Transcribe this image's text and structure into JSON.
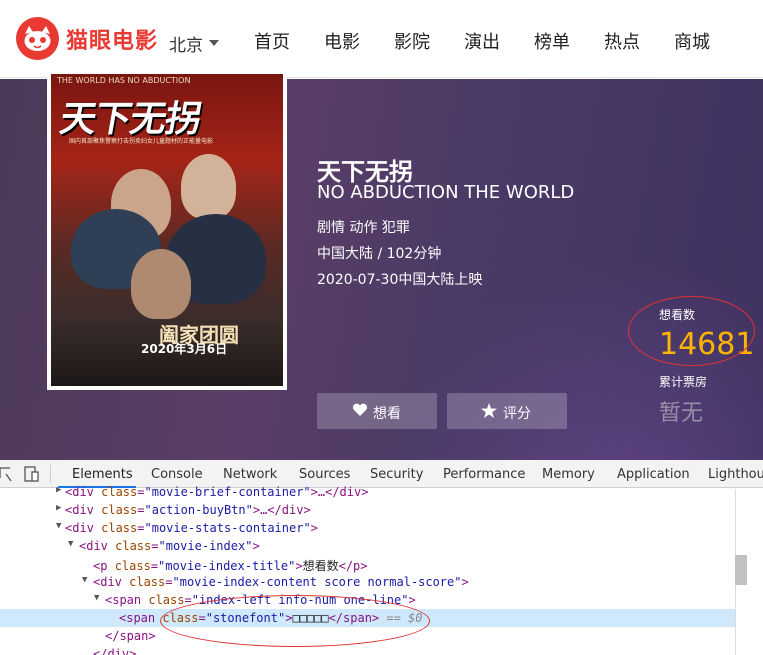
{
  "header": {
    "brand": "猫眼电影",
    "city": "北京",
    "nav": [
      "首页",
      "电影",
      "影院",
      "演出",
      "榜单",
      "热点",
      "商城"
    ]
  },
  "movie": {
    "title": "天下无拐",
    "english_title": "NO ABDUCTION THE WORLD",
    "genres": "剧情 动作 犯罪",
    "region_duration": "中国大陆 / 102分钟",
    "release": "2020-07-30中国大陆上映",
    "want_label": "想看",
    "rate_label": "评分"
  },
  "poster": {
    "top_text": "THE WORLD HAS NO ABDUCTION",
    "title": "天下无拐",
    "subtitle": "国内首部聚焦警察打击拐卖妇女儿童题材的正能量电影",
    "brand": "阖家团圆",
    "date": "2020年3月6日"
  },
  "stats": {
    "want_count_label": "想看数",
    "want_count": "14681",
    "box_office_label": "累计票房",
    "box_office_value": "暂无"
  },
  "devtools": {
    "tabs": [
      "Elements",
      "Console",
      "Network",
      "Sources",
      "Security",
      "Performance",
      "Memory",
      "Application",
      "Lighthouse"
    ],
    "active_tab": "Elements",
    "lines": [
      {
        "pre": "<div class=\"",
        "cls": "movie-brief-container",
        "post": "\">…</div>"
      },
      {
        "pre": "<div class=\"",
        "cls": "action-buyBtn",
        "post": "\">…</div>"
      },
      {
        "pre": "<div class=\"",
        "cls": "movie-stats-container",
        "post": "\">"
      },
      {
        "pre": "<div class=\"",
        "cls": "movie-index",
        "post": "\">"
      },
      {
        "pre": "<p class=\"",
        "cls": "movie-index-title",
        "post": "\">",
        "text": "想看数",
        "close": "</p>"
      },
      {
        "pre": "<div class=\"",
        "cls": "movie-index-content score normal-score",
        "post": "\">"
      },
      {
        "pre": "<span class=\"",
        "cls": "index-left info-num one-line",
        "post": "\">"
      },
      {
        "pre": "<span class=\"",
        "cls": "stonefont",
        "post": "\">",
        "text": "□□□□□",
        "close": "</span>",
        "note": " == $0"
      },
      {
        "pre": "</span>",
        "cls": "",
        "post": ""
      },
      {
        "pre": "</div>",
        "cls": "",
        "post": ""
      }
    ]
  }
}
